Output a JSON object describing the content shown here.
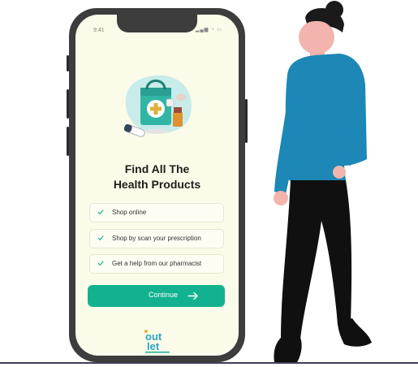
{
  "status_bar": {
    "time": "9:41",
    "icons": "▂▄▆ ◔ ▭"
  },
  "onboarding": {
    "title_line1": "Find All The",
    "title_line2": "Health Products",
    "features": [
      {
        "label": "Shop online"
      },
      {
        "label": "Shop by scan your prescription"
      },
      {
        "label": "Get a help from our pharmacist"
      }
    ],
    "continue_label": "Continue"
  },
  "logo": {
    "word_top": "out",
    "word_bottom": "let"
  },
  "colors": {
    "accent": "#13b28f",
    "screen_bg": "#fbfbe9",
    "phone_frame": "#3d3d3d",
    "shirt": "#1d87b6",
    "pants": "#101010"
  }
}
